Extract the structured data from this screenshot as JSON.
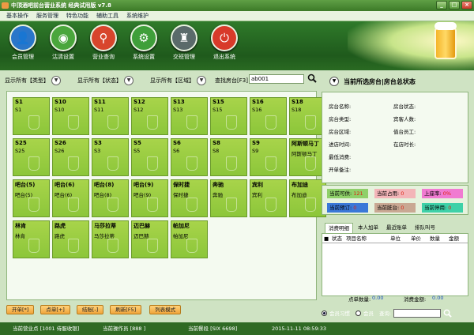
{
  "window": {
    "title": "中顶酒吧前台营业系统 经典试用版 v7.8",
    "minimize": "_",
    "maximize": "□",
    "close": "×"
  },
  "menu": [
    "基本操作",
    "服务管理",
    "特色功能",
    "辅助工具",
    "系统维护"
  ],
  "nav": [
    {
      "label": "会员管理",
      "icon": "member-icon",
      "color": "#2a76c9",
      "glyph": "👤"
    },
    {
      "label": "沽清设置",
      "icon": "dish-icon",
      "color": "#4aa63c",
      "glyph": "◉"
    },
    {
      "label": "营业查询",
      "icon": "magnifier-icon",
      "color": "#d8452c",
      "glyph": "⚲"
    },
    {
      "label": "系统设置",
      "icon": "gear-icon",
      "color": "#3f9f3a",
      "glyph": "⚙"
    },
    {
      "label": "交班管理",
      "icon": "team-icon",
      "color": "#5a6a6a",
      "glyph": "♜"
    },
    {
      "label": "退出系统",
      "icon": "power-icon",
      "color": "#d83a2a",
      "glyph": "⏻"
    }
  ],
  "filters": {
    "type": "显示所有【类型】",
    "status": "显示所有【状态】",
    "area": "显示所有【区域】",
    "search_label": "查找房台[F3]",
    "search_value": "ab001"
  },
  "rooms": [
    {
      "code": "S1",
      "sub": "S1"
    },
    {
      "code": "S10",
      "sub": "S10"
    },
    {
      "code": "S11",
      "sub": "S11"
    },
    {
      "code": "S12",
      "sub": "S12"
    },
    {
      "code": "S13",
      "sub": "S13"
    },
    {
      "code": "S15",
      "sub": "S15"
    },
    {
      "code": "S16",
      "sub": "S16"
    },
    {
      "code": "S18",
      "sub": "S18"
    },
    {
      "code": "S25",
      "sub": "S25"
    },
    {
      "code": "S26",
      "sub": "S26"
    },
    {
      "code": "S3",
      "sub": "S3"
    },
    {
      "code": "S5",
      "sub": "S5"
    },
    {
      "code": "S6",
      "sub": "S6"
    },
    {
      "code": "S8",
      "sub": "S8"
    },
    {
      "code": "S9",
      "sub": "S9"
    },
    {
      "code": "阿斯顿马丁",
      "sub": "阿斯顿马丁"
    },
    {
      "code": "吧台(5)",
      "sub": "吧台(5)"
    },
    {
      "code": "吧台(6)",
      "sub": "吧台(6)"
    },
    {
      "code": "吧台(8)",
      "sub": "吧台(8)"
    },
    {
      "code": "吧台(9)",
      "sub": "吧台(9)"
    },
    {
      "code": "保时捷",
      "sub": "保时捷"
    },
    {
      "code": "奔驰",
      "sub": "奔驰"
    },
    {
      "code": "宾利",
      "sub": "宾利"
    },
    {
      "code": "布加迪",
      "sub": "布加迪"
    },
    {
      "code": "林肯",
      "sub": "林肯"
    },
    {
      "code": "路虎",
      "sub": "路虎"
    },
    {
      "code": "马莎拉蒂",
      "sub": "马莎拉蒂"
    },
    {
      "code": "迈巴赫",
      "sub": "迈巴赫"
    },
    {
      "code": "帕加尼",
      "sub": "帕加尼"
    }
  ],
  "actions": [
    "开单[*]",
    "点单[+]",
    "结账[-]",
    "刷新[F5]",
    "列表模式"
  ],
  "status_bar": {
    "store": "当前营业点 [1001 侍服收银]",
    "operator": "当前操作员 [888 ]",
    "shift": "当前餐段 [SIX 6698]",
    "datetime": "2015-11-11  08:59:33"
  },
  "panel": {
    "title": "当前所选房台|房台总状态",
    "labels_left": [
      "房台名称:",
      "房台类型:",
      "房台区域:",
      "进店时间:",
      "最低消费:",
      "开单备注:"
    ],
    "labels_right": [
      "房台状态:",
      "宾客人数:",
      "值台员工:",
      "在店时长:"
    ],
    "stats": [
      {
        "label": "当前可供:",
        "value": "121",
        "color": "#8fd06a",
        "valcolor": "#d21"
      },
      {
        "label": "当前占用:",
        "value": "0",
        "color": "#f3b5b8",
        "valcolor": "#d21"
      },
      {
        "label": "上座率:",
        "value": "0%",
        "color": "#f07bd1",
        "valcolor": "#d21"
      },
      {
        "label": "当前预订:",
        "value": "0",
        "color": "#3a78d8",
        "valcolor": "#d21"
      },
      {
        "label": "当前脏台:",
        "value": "0",
        "color": "#c9a893",
        "valcolor": "#d21"
      },
      {
        "label": "当前停用:",
        "value": "0",
        "color": "#3ed1a8",
        "valcolor": "#d21"
      }
    ],
    "tabs": [
      "消费明细",
      "本人加单",
      "最近账单",
      "排队叫号"
    ],
    "columns": [
      "状态",
      "项目名称",
      "单位",
      "单价",
      "数量",
      "金额"
    ],
    "summary_count_label": "点单数量:",
    "summary_count": "0.00",
    "summary_amount_label": "消费金额:",
    "summary_amount": "0.00",
    "opt_member_label": "会员习惯",
    "opt_member_on": true,
    "opt_vip_label": "会员",
    "opt_query_label": "查询:"
  }
}
